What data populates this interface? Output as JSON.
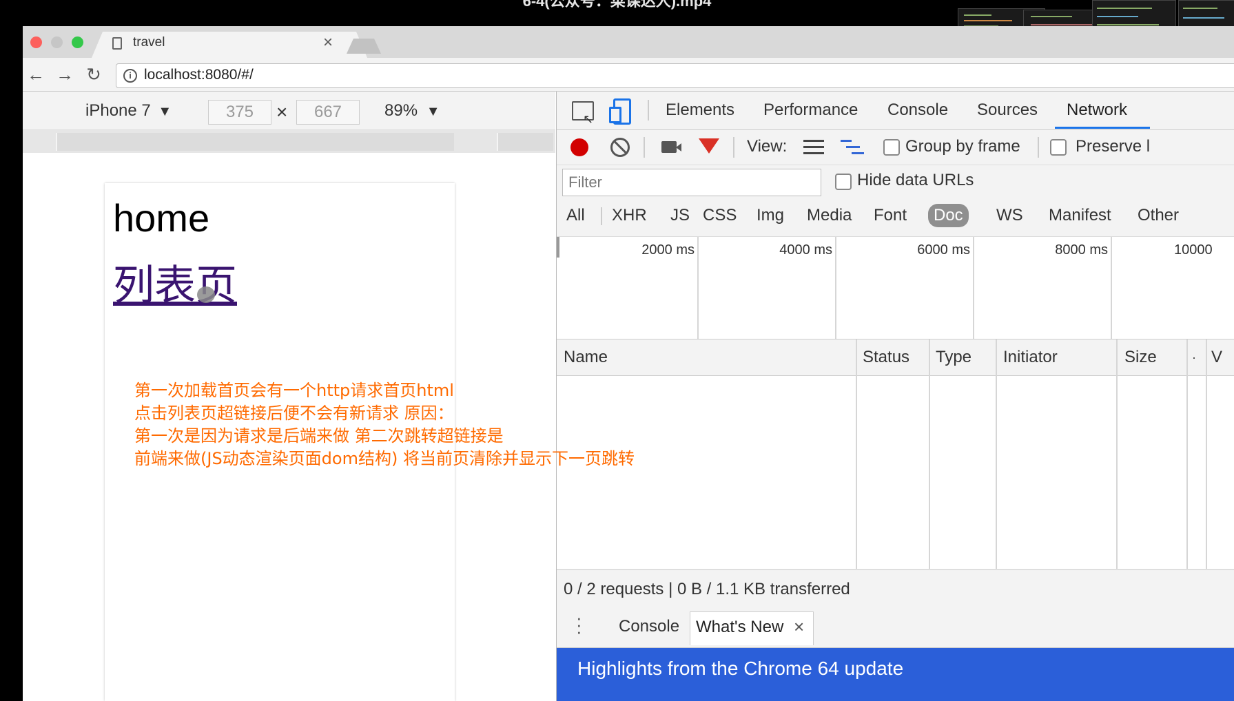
{
  "video": {
    "title": "6-4(公众号：菜课达人).mp4"
  },
  "browser": {
    "tab_title": "travel",
    "tab_close": "×",
    "address": "localhost:8080/#/",
    "nav_icons": [
      "back-arrow-icon",
      "forward-arrow-icon",
      "reload-icon"
    ],
    "traffic_colors": [
      "#fc605c",
      "#fdbc40",
      "#34c84a"
    ]
  },
  "device_toolbar": {
    "device": "iPhone 7",
    "width": "375",
    "times": "×",
    "height": "667",
    "zoom": "89%"
  },
  "page": {
    "heading": "home",
    "link": "列表页",
    "link_color": "#3a1470",
    "notes": [
      "第一次加载首页会有一个http请求首页html",
      "点击列表页超链接后便不会有新请求 原因：",
      "第一次是因为请求是后端来做 第二次跳转超链接是",
      "前端来做(JS动态渲染页面dom结构) 将当前页清除并显示下一页跳转"
    ],
    "notes_color": "#ff6a00"
  },
  "devtools": {
    "tabs": [
      "Elements",
      "Performance",
      "Console",
      "Sources",
      "Network"
    ],
    "active_tab": "Network",
    "toolbar": {
      "view_label": "View:",
      "group_by_frame": "Group by frame",
      "preserve_log": "Preserve l"
    },
    "filter_placeholder": "Filter",
    "hide_data_urls": "Hide data URLs",
    "types": [
      "All",
      "XHR",
      "JS",
      "CSS",
      "Img",
      "Media",
      "Font",
      "Doc",
      "WS",
      "Manifest",
      "Other"
    ],
    "active_type": "Doc",
    "timeline_ticks": [
      "2000 ms",
      "4000 ms",
      "6000 ms",
      "8000 ms",
      "10000"
    ],
    "columns": [
      "Name",
      "Status",
      "Type",
      "Initiator",
      "Size",
      "·",
      "V"
    ],
    "summary": "0 / 2 requests | 0 B / 1.1 KB transferred",
    "drawer": {
      "tabs": [
        "Console",
        "What's New"
      ],
      "close": "×",
      "banner": "Highlights from the Chrome 64 update",
      "banner_color": "#2b5fd9"
    }
  }
}
